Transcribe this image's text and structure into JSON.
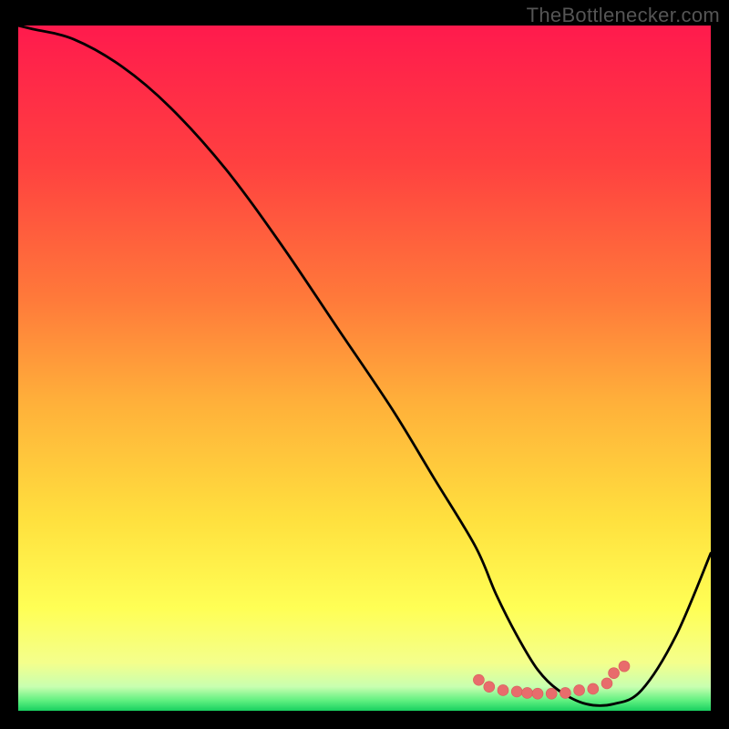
{
  "watermark": "TheBottlenecker.com",
  "chart_data": {
    "type": "line",
    "title": "",
    "xlabel": "",
    "ylabel": "",
    "xlim": [
      0,
      100
    ],
    "ylim": [
      0,
      100
    ],
    "x": [
      0,
      2,
      8,
      15,
      22,
      30,
      38,
      46,
      54,
      60,
      66,
      69,
      72,
      75,
      78,
      82,
      86,
      90,
      95,
      100
    ],
    "values": [
      100,
      99.5,
      98,
      94,
      88,
      79,
      68,
      56,
      44,
      34,
      24,
      17,
      11,
      6,
      3,
      1,
      1,
      3,
      11,
      23
    ],
    "markers": {
      "x": [
        66.5,
        68,
        70,
        72,
        73.5,
        75,
        77,
        79,
        81,
        83,
        85,
        86,
        87.5
      ],
      "y": [
        4.5,
        3.5,
        3,
        2.8,
        2.6,
        2.5,
        2.5,
        2.6,
        3,
        3.2,
        4,
        5.5,
        6.5
      ]
    },
    "gradient": {
      "stops": [
        {
          "offset": 0.0,
          "color": "#ff1a4d"
        },
        {
          "offset": 0.2,
          "color": "#ff4040"
        },
        {
          "offset": 0.4,
          "color": "#ff7a3a"
        },
        {
          "offset": 0.55,
          "color": "#ffb03a"
        },
        {
          "offset": 0.72,
          "color": "#ffe03e"
        },
        {
          "offset": 0.85,
          "color": "#ffff55"
        },
        {
          "offset": 0.93,
          "color": "#f4ff8c"
        },
        {
          "offset": 0.965,
          "color": "#c8ffb0"
        },
        {
          "offset": 0.985,
          "color": "#60f080"
        },
        {
          "offset": 1.0,
          "color": "#18d060"
        }
      ]
    },
    "style": {
      "line_color": "#000000",
      "line_width": 2.8,
      "marker_color": "#e86c6c",
      "marker_radius": 6
    }
  }
}
